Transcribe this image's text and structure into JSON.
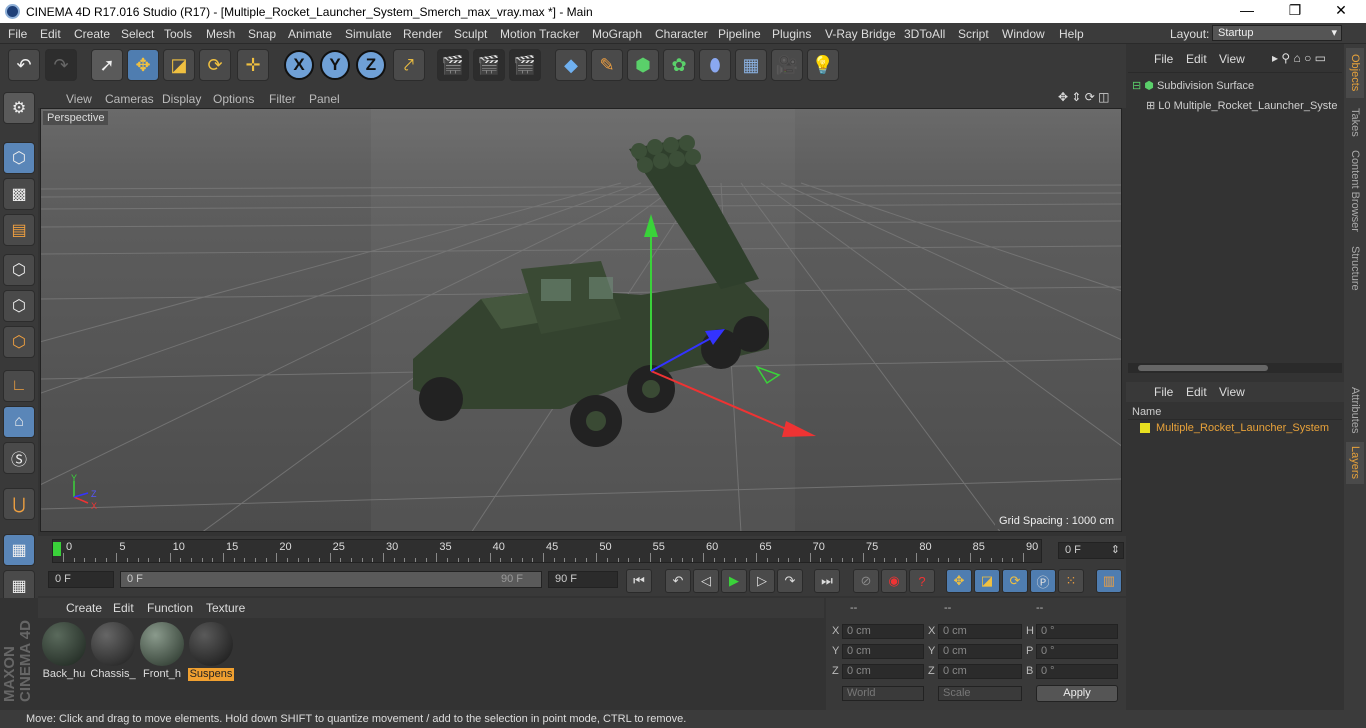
{
  "window": {
    "title": "CINEMA 4D R17.016 Studio (R17) - [Multiple_Rocket_Launcher_System_Smerch_max_vray.max *] - Main",
    "controls": [
      "—",
      "❐",
      "✕"
    ]
  },
  "menu": [
    "File",
    "Edit",
    "Create",
    "Select",
    "Tools",
    "Mesh",
    "Snap",
    "Animate",
    "Simulate",
    "Render",
    "Sculpt",
    "Motion Tracker",
    "MoGraph",
    "Character",
    "Pipeline",
    "Plugins",
    "V-Ray Bridge",
    "3DToAll",
    "Script",
    "Window",
    "Help"
  ],
  "layout": {
    "label": "Layout:",
    "value": "Startup"
  },
  "viewport": {
    "menu": [
      "View",
      "Cameras",
      "Display",
      "Options",
      "Filter",
      "Panel"
    ],
    "camera_label": "Perspective",
    "grid_spacing": "Grid Spacing : 1000 cm",
    "axis_labels": {
      "y": "Y",
      "z": "Z",
      "x": "X"
    }
  },
  "timeline": {
    "ticks": [
      "0",
      "5",
      "10",
      "15",
      "20",
      "25",
      "30",
      "35",
      "40",
      "45",
      "50",
      "55",
      "60",
      "65",
      "70",
      "75",
      "80",
      "85",
      "90"
    ],
    "current_frame": "0 F"
  },
  "animbar": {
    "start_field": "0 F",
    "range_start": "0 F",
    "range_end": "90 F",
    "end_field": "90 F"
  },
  "materials": {
    "menu": [
      "Create",
      "Edit",
      "Function",
      "Texture"
    ],
    "items": [
      {
        "label": "Back_hu",
        "selected": false,
        "color": "#2f3d33"
      },
      {
        "label": "Chassis_",
        "selected": false,
        "color": "#3a3a3a"
      },
      {
        "label": "Front_h",
        "selected": false,
        "color": "#4a5a4c"
      },
      {
        "label": "Suspens",
        "selected": true,
        "color": "#2e2e2e"
      }
    ]
  },
  "coordinates": {
    "headers": [
      "--",
      "--",
      "--"
    ],
    "rows": [
      {
        "a": "X",
        "av": "0 cm",
        "b": "X",
        "bv": "0 cm",
        "c": "H",
        "cv": "0 °"
      },
      {
        "a": "Y",
        "av": "0 cm",
        "b": "Y",
        "bv": "0 cm",
        "c": "P",
        "cv": "0 °"
      },
      {
        "a": "Z",
        "av": "0 cm",
        "b": "Z",
        "bv": "0 cm",
        "c": "B",
        "cv": "0 °"
      }
    ],
    "mode_world": "World",
    "mode_scale": "Scale",
    "apply": "Apply"
  },
  "objects": {
    "menu": [
      "File",
      "Edit",
      "View"
    ],
    "tree": [
      {
        "label": "Subdivision Surface",
        "color": "#cfcfcf"
      },
      {
        "label": "Multiple_Rocket_Launcher_Syste",
        "color": "#cfcfcf"
      }
    ]
  },
  "layers": {
    "menu": [
      "File",
      "Edit",
      "View"
    ],
    "header": "Name",
    "items": [
      {
        "label": "Multiple_Rocket_Launcher_System",
        "color": "#e8a23a"
      }
    ]
  },
  "side_tabs": [
    "Objects",
    "Takes",
    "Content Browser",
    "Structure",
    "Attributes",
    "Layers"
  ],
  "maxon_logo": "MAXON CINEMA 4D",
  "status": "Move: Click and drag to move elements. Hold down SHIFT to quantize movement / add to the selection in point mode, CTRL to remove."
}
